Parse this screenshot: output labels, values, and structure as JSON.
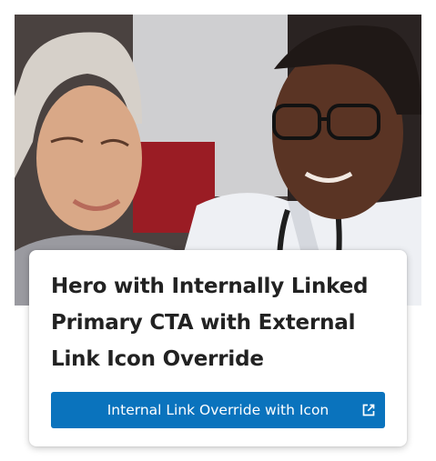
{
  "hero": {
    "image_icon": "photo-patient-and-doctor",
    "title": "Hero with Internally Linked Primary CTA with External Link Icon Override",
    "cta": {
      "label": "Internal Link Override with Icon",
      "icon": "external-link-icon"
    }
  },
  "colors": {
    "cta_background": "#0a73bd",
    "cta_text": "#ffffff",
    "title_text": "#222222",
    "card_background": "#ffffff"
  }
}
